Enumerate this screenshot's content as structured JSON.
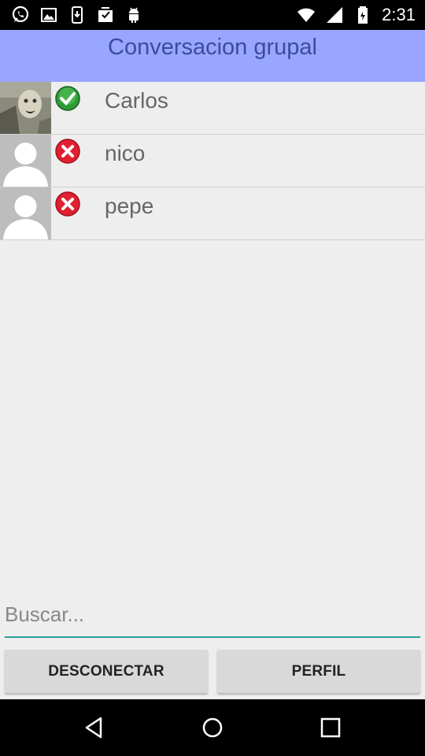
{
  "status_bar": {
    "time": "2:31",
    "left_icons": [
      "whatsapp-icon",
      "image-icon",
      "phone-download-icon",
      "inbox-check-icon",
      "android-icon"
    ],
    "right_icons": [
      "wifi-icon",
      "signal-icon",
      "battery-icon"
    ]
  },
  "app_bar": {
    "title": "Conversacion grupal",
    "color": "#99a6ff"
  },
  "users": [
    {
      "name": "Carlos",
      "status": "online",
      "status_icon": "check-icon",
      "avatar": "photo"
    },
    {
      "name": "nico",
      "status": "offline",
      "status_icon": "x-icon",
      "avatar": "default-person"
    },
    {
      "name": "pepe",
      "status": "offline",
      "status_icon": "x-icon",
      "avatar": "default-person"
    }
  ],
  "search": {
    "placeholder": "Buscar...",
    "value": ""
  },
  "buttons": {
    "disconnect_label": "DESCONECTAR",
    "profile_label": "PERFIL"
  },
  "nav_bar": {
    "icons": [
      "back-icon",
      "home-icon",
      "recents-icon"
    ]
  },
  "colors": {
    "online": "#2e9b35",
    "offline": "#e02030",
    "accent": "#2aa198"
  }
}
